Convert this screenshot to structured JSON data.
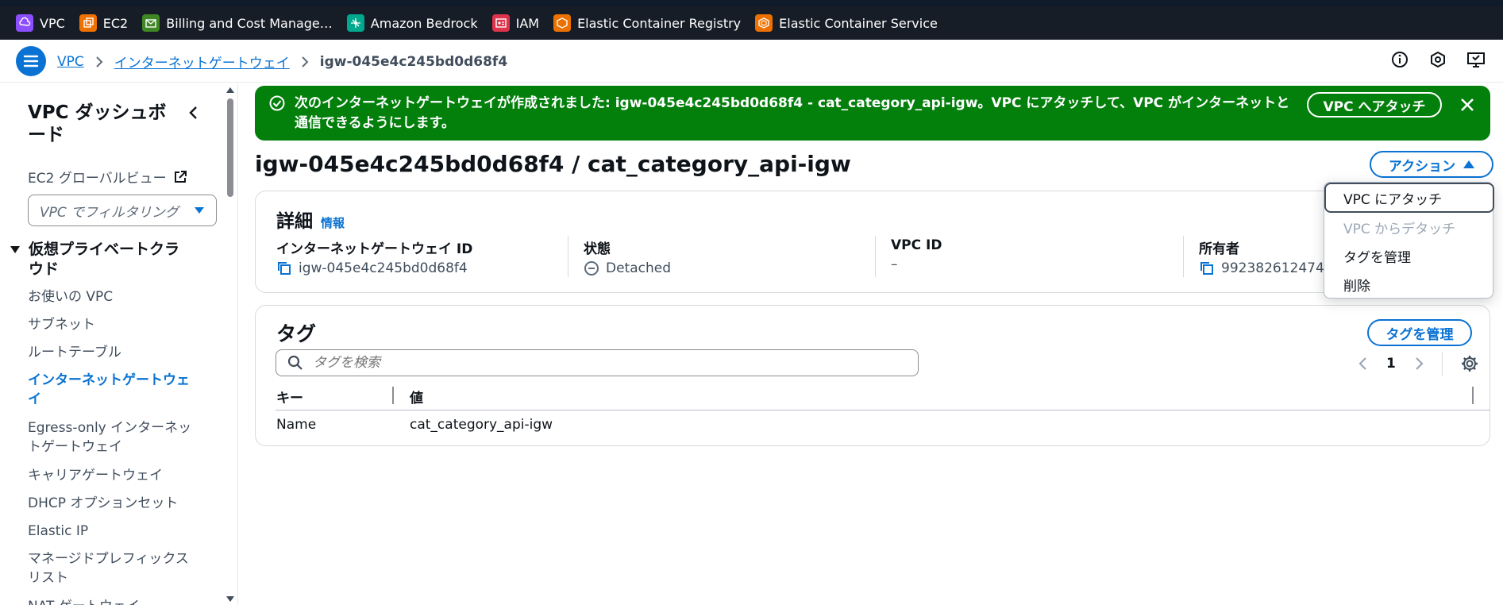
{
  "topbar": {
    "services": [
      {
        "label": "VPC",
        "color": "#8c4fff",
        "icon": "vpc-icon"
      },
      {
        "label": "EC2",
        "color": "#ed7100",
        "icon": "ec2-icon"
      },
      {
        "label": "Billing and Cost Manage…",
        "color": "#3f8624",
        "icon": "billing-icon"
      },
      {
        "label": "Amazon Bedrock",
        "color": "#01a88d",
        "icon": "bedrock-icon"
      },
      {
        "label": "IAM",
        "color": "#dd344c",
        "icon": "iam-icon"
      },
      {
        "label": "Elastic Container Registry",
        "color": "#ed7100",
        "icon": "ecr-icon"
      },
      {
        "label": "Elastic Container Service",
        "color": "#ed7100",
        "icon": "ecs-icon"
      }
    ]
  },
  "breadcrumb": {
    "items": [
      "VPC",
      "インターネットゲートウェイ"
    ],
    "current": "igw-045e4c245bd0d68f4"
  },
  "sidebar": {
    "title": "VPC ダッシュボード",
    "ec2_global_view": "EC2 グローバルビュー",
    "filter_placeholder": "VPC でフィルタリング",
    "section": "仮想プライベートクラウド",
    "items": [
      "お使いの VPC",
      "サブネット",
      "ルートテーブル",
      "インターネットゲートウェイ",
      "Egress-only インターネットゲートウェイ",
      "キャリアゲートウェイ",
      "DHCP オプションセット",
      "Elastic IP",
      "マネージドプレフィックスリスト",
      "NAT ゲートウェイ"
    ],
    "active_index": 3
  },
  "flash": {
    "message": "次のインターネットゲートウェイが作成されました: igw-045e4c245bd0d68f4 - cat_category_api-igw。VPC にアタッチして、VPC がインターネットと通信できるようにします。",
    "button": "VPC へアタッチ",
    "color": "#037f0c"
  },
  "page": {
    "title": "igw-045e4c245bd0d68f4 / cat_category_api-igw",
    "actions_label": "アクション"
  },
  "details": {
    "heading": "詳細",
    "info": "情報",
    "columns": [
      {
        "label": "インターネットゲートウェイ ID",
        "value": "igw-045e4c245bd0d68f4"
      },
      {
        "label": "状態",
        "value": "Detached"
      },
      {
        "label": "VPC ID",
        "value": "–"
      },
      {
        "label": "所有者",
        "value": "992382612474"
      }
    ]
  },
  "tags": {
    "heading": "タグ",
    "manage_button": "タグを管理",
    "search_placeholder": "タグを検索",
    "page": "1",
    "columns": [
      "キー",
      "値"
    ],
    "rows": [
      {
        "key": "Name",
        "value": "cat_category_api-igw"
      }
    ]
  },
  "actions_menu": {
    "items": [
      "VPC にアタッチ",
      "VPC からデタッチ",
      "タグを管理",
      "削除"
    ]
  }
}
